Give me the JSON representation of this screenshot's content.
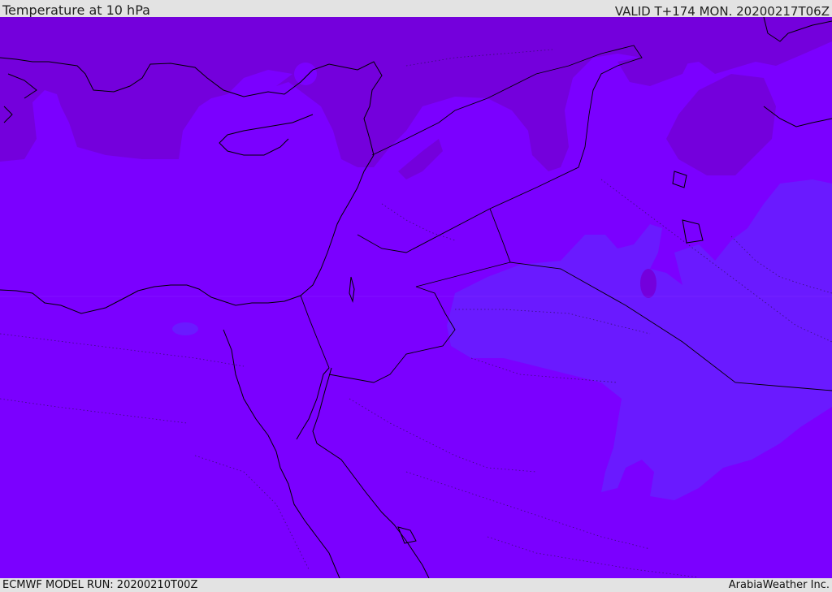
{
  "header": {
    "title": "Temperature at 10 hPa",
    "valid": "VALID T+174 MON. 20200217T06Z"
  },
  "footer": {
    "model_run": "ECMWF MODEL RUN: 20200210T00Z",
    "credit": "ArabiaWeather Inc."
  },
  "map": {
    "colors": {
      "background": "#7b00ff",
      "warm_band": "#7400dc",
      "cool_band": "#6a1aff",
      "coast": "#000000",
      "border_dotted": "#3a1a6a"
    }
  }
}
